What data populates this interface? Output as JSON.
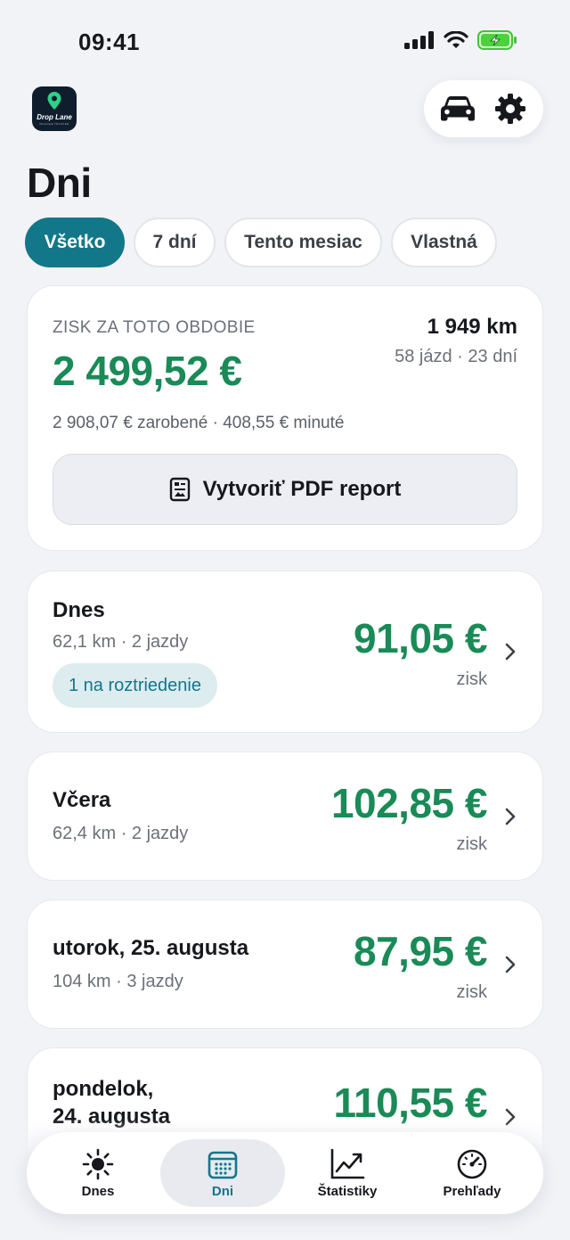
{
  "status_bar": {
    "time": "09:41"
  },
  "header": {
    "title": "Dni",
    "app_logo_text": "Drop Lane",
    "app_logo_sub": "MILEAGE TRACKER"
  },
  "filters": [
    {
      "label": "Všetko",
      "active": true
    },
    {
      "label": "7 dní",
      "active": false
    },
    {
      "label": "Tento mesiac",
      "active": false
    },
    {
      "label": "Vlastná",
      "active": false
    }
  ],
  "summary": {
    "label": "ZISK ZA TOTO OBDOBIE",
    "profit": "2 499,52 €",
    "km": "1 949 km",
    "trips": "58 jázd · 23 dní",
    "detail": "2 908,07 € zarobené · 408,55 € minuté",
    "pdf_button": "Vytvoriť PDF report"
  },
  "days": [
    {
      "title": "Dnes",
      "meta": "62,1 km · 2 jazdy",
      "amount": "91,05 €",
      "unit": "zisk",
      "badge": "1 na roztriedenie"
    },
    {
      "title": "Včera",
      "meta": "62,4 km · 2 jazdy",
      "amount": "102,85 €",
      "unit": "zisk"
    },
    {
      "title": "utorok, 25. augusta",
      "meta": "104 km · 3 jazdy",
      "amount": "87,95 €",
      "unit": "zisk"
    },
    {
      "title_line1": "pondelok,",
      "title_line2": "24. augusta",
      "amount": "110,55 €"
    }
  ],
  "tabs": [
    {
      "label": "Dnes",
      "icon": "sun-icon",
      "active": false
    },
    {
      "label": "Dni",
      "icon": "calendar-icon",
      "active": true
    },
    {
      "label": "Štatistiky",
      "icon": "chart-icon",
      "active": false
    },
    {
      "label": "Prehľady",
      "icon": "speedometer-icon",
      "active": false
    }
  ],
  "colors": {
    "accent": "#13778a",
    "profit": "#1a8a57",
    "background": "#f2f3f7"
  }
}
